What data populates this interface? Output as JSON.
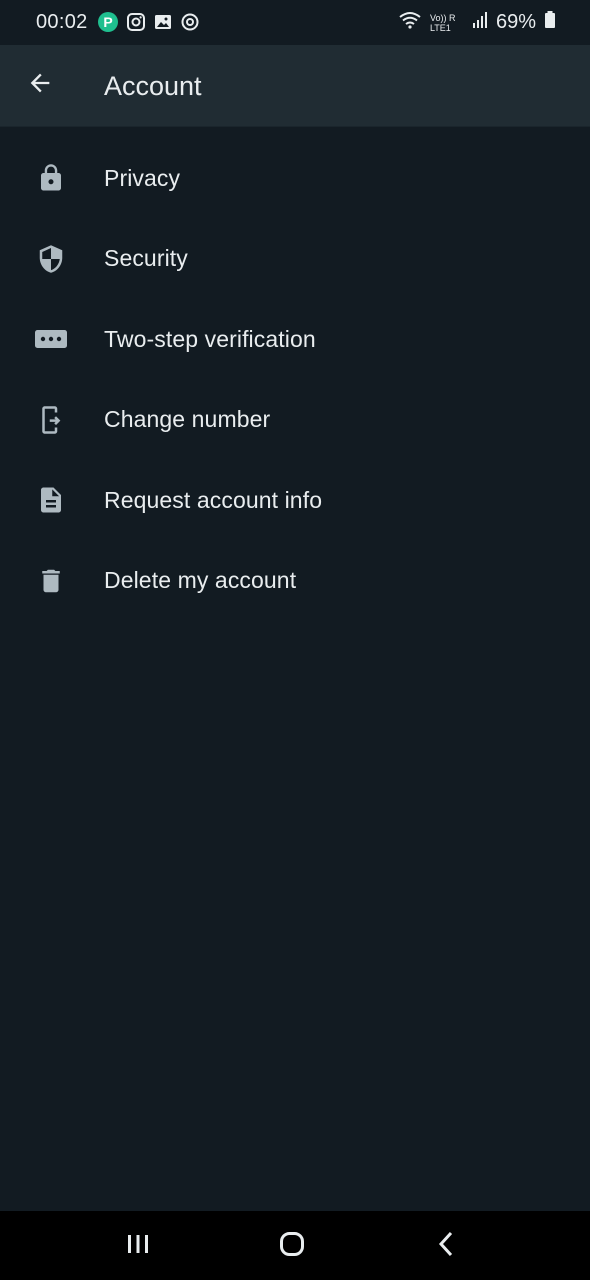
{
  "status_bar": {
    "time": "00:02",
    "battery": "69%",
    "network_label": "Vo)) R LTE1",
    "left_icons": [
      "paytm-icon",
      "instagram-icon",
      "gallery-icon",
      "data-saver-icon"
    ],
    "right_icons": [
      "wifi-icon",
      "signal-icon",
      "battery-icon"
    ]
  },
  "app_bar": {
    "title": "Account",
    "back_icon": "arrow-left-icon"
  },
  "menu": {
    "items": [
      {
        "label": "Privacy",
        "icon": "lock-icon"
      },
      {
        "label": "Security",
        "icon": "shield-icon"
      },
      {
        "label": "Two-step verification",
        "icon": "dots-icon"
      },
      {
        "label": "Change number",
        "icon": "change-number-icon"
      },
      {
        "label": "Request account info",
        "icon": "document-icon"
      },
      {
        "label": "Delete my account",
        "icon": "trash-icon"
      }
    ]
  },
  "nav_bar": {
    "items": [
      "recents-icon",
      "home-icon",
      "back-icon"
    ]
  },
  "colors": {
    "background": "#121b22",
    "app_bar": "#202c33",
    "text": "#e9edef",
    "icon": "#aebac1"
  }
}
